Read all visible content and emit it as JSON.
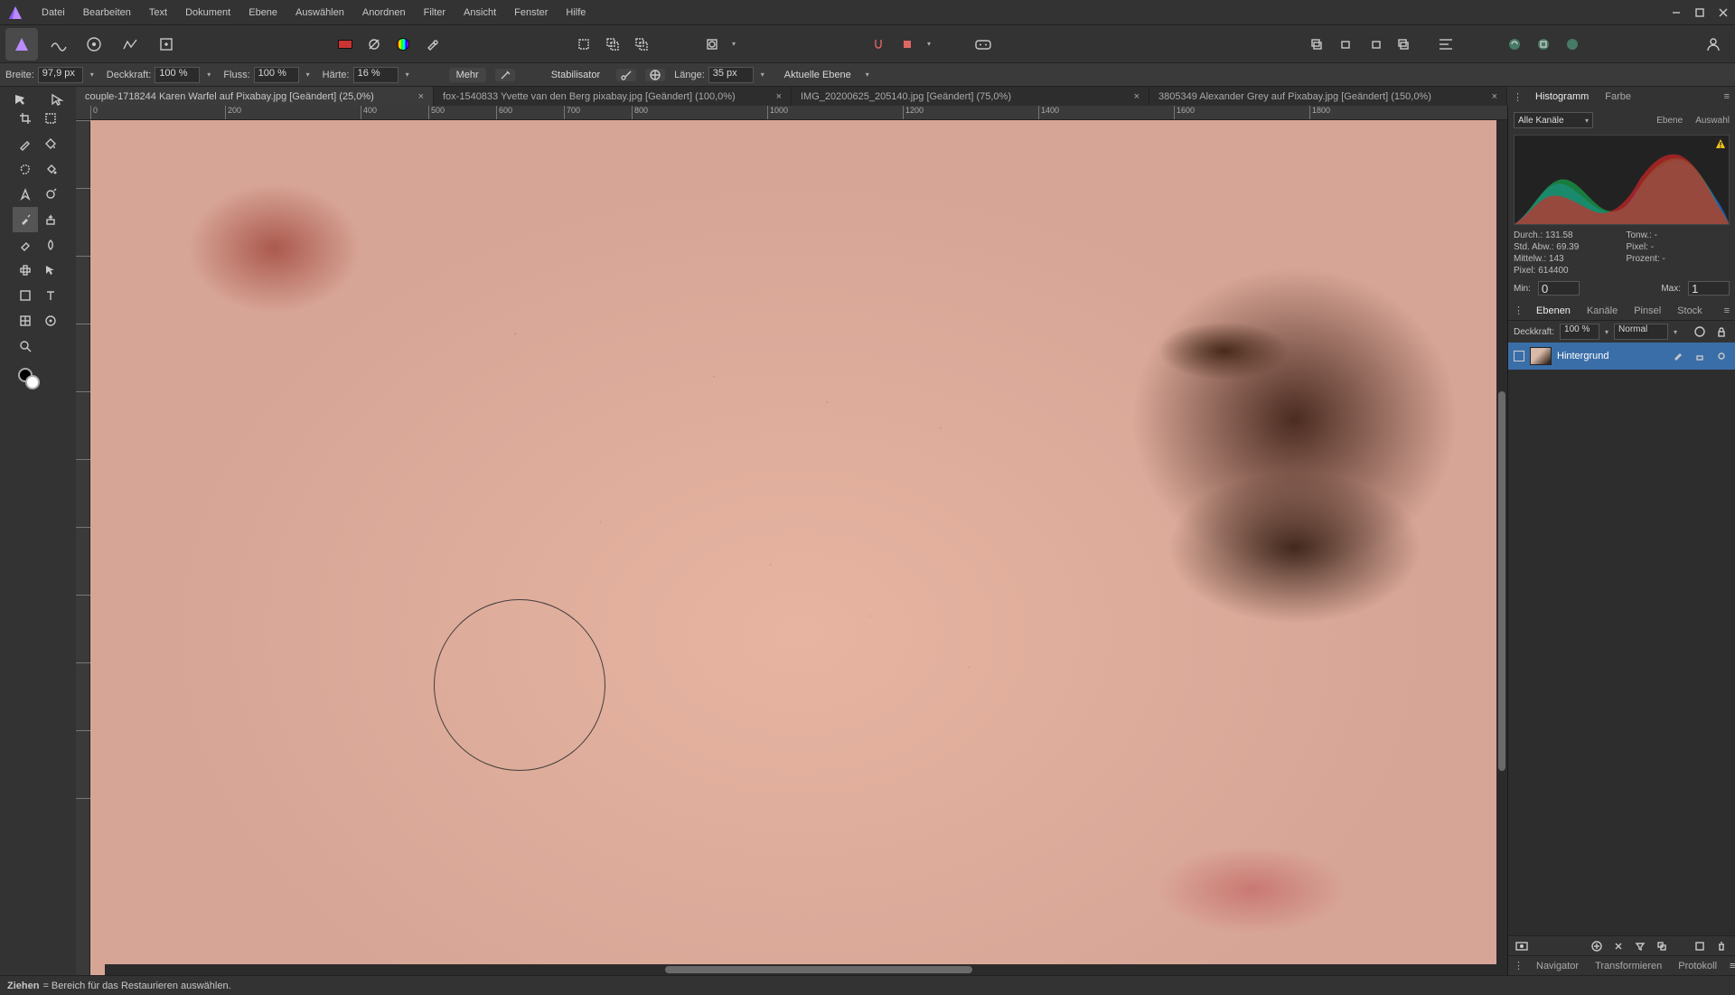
{
  "menubar": {
    "items": [
      "Datei",
      "Bearbeiten",
      "Text",
      "Dokument",
      "Ebene",
      "Auswählen",
      "Anordnen",
      "Filter",
      "Ansicht",
      "Fenster",
      "Hilfe"
    ]
  },
  "context": {
    "breite_label": "Breite:",
    "breite_value": "97,9 px",
    "deckkraft_label": "Deckkraft:",
    "deckkraft_value": "100 %",
    "fluss_label": "Fluss:",
    "fluss_value": "100 %",
    "haerte_label": "Härte:",
    "haerte_value": "16 %",
    "mehr": "Mehr",
    "stabilisator": "Stabilisator",
    "laenge_label": "Länge:",
    "laenge_value": "35 px",
    "aktuelle_ebene": "Aktuelle Ebene"
  },
  "tabs": [
    {
      "label": "couple-1718244 Karen Warfel auf Pixabay.jpg [Geändert] (25,0%)",
      "active": true
    },
    {
      "label": "fox-1540833 Yvette van den Berg pixabay.jpg [Geändert] (100,0%)",
      "active": false
    },
    {
      "label": "IMG_20200625_205140.jpg [Geändert] (75,0%)",
      "active": false
    },
    {
      "label": "3805349 Alexander Grey auf Pixabay.jpg [Geändert] (150,0%)",
      "active": false
    }
  ],
  "ruler_h": [
    0,
    200,
    400,
    600,
    700,
    800,
    1000,
    1200,
    1400,
    1600,
    1800
  ],
  "panels": {
    "hist_tab": "Histogramm",
    "farbe_tab": "Farbe",
    "channel_sel": "Alle Kanäle",
    "ebene_link": "Ebene",
    "auswahl_link": "Auswahl",
    "stats": {
      "durch_label": "Durch.:",
      "durch_val": "131.58",
      "tonw_label": "Tonw.:",
      "tonw_val": "-",
      "std_label": "Std. Abw.:",
      "std_val": "69.39",
      "pixel2_label": "Pixel:",
      "pixel2_val": "-",
      "mittel_label": "Mittelw.:",
      "mittel_val": "143",
      "prozent_label": "Prozent:",
      "prozent_val": "-",
      "pixel_label": "Pixel:",
      "pixel_val": "614400"
    },
    "min_label": "Min:",
    "min_val": "0",
    "max_label": "Max:",
    "max_val": "1",
    "layers_tabs": [
      "Ebenen",
      "Kanäle",
      "Pinsel",
      "Stock"
    ],
    "layers_opacity_label": "Deckkraft:",
    "layers_opacity_val": "100 %",
    "layers_blend": "Normal",
    "layer0_name": "Hintergrund",
    "nav_tabs": [
      "Navigator",
      "Transformieren",
      "Protokoll"
    ]
  },
  "status": {
    "bold": "Ziehen",
    "rest": " = Bereich für das Restaurieren auswählen."
  }
}
